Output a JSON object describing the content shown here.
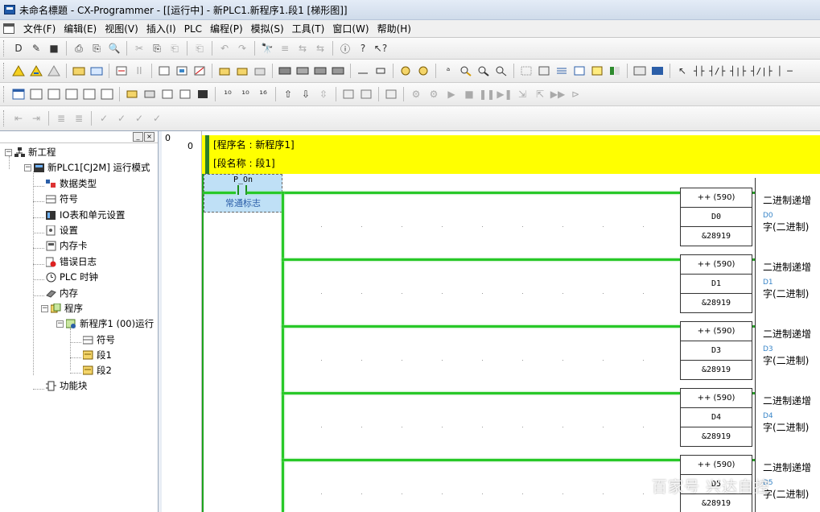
{
  "window": {
    "title": "未命名標題 - CX-Programmer - [[运行中] - 新PLC1.新程序1.段1 [梯形图]]"
  },
  "menu": [
    "文件(F)",
    "编辑(E)",
    "视图(V)",
    "插入(I)",
    "PLC",
    "编程(P)",
    "模拟(S)",
    "工具(T)",
    "窗口(W)",
    "帮助(H)"
  ],
  "toolbar1": [
    "D",
    "✎",
    "■",
    "⎙",
    "⎘",
    "🔍",
    "✂",
    "⎘",
    "⎗",
    "⎗",
    "↶",
    "↷",
    "🔭",
    "≡",
    "⇆",
    "⇆",
    "ⓘ",
    "?",
    "↖?"
  ],
  "toolbar2_ladder_symbols": [
    "┤├",
    "┤/├",
    "┤|├",
    "┤/|├",
    "│",
    "─"
  ],
  "tree": {
    "nodes": [
      {
        "label": "新工程",
        "icon": "project-icon"
      },
      {
        "label": "新PLC1[CJ2M] 运行模式",
        "icon": "plc-icon"
      },
      {
        "label": "数据类型",
        "icon": "datatype-icon"
      },
      {
        "label": "符号",
        "icon": "symbols-icon"
      },
      {
        "label": "IO表和单元设置",
        "icon": "io-table-icon"
      },
      {
        "label": "设置",
        "icon": "settings-icon"
      },
      {
        "label": "内存卡",
        "icon": "memory-card-icon"
      },
      {
        "label": "错误日志",
        "icon": "error-log-icon"
      },
      {
        "label": "PLC 时钟",
        "icon": "clock-icon"
      },
      {
        "label": "内存",
        "icon": "memory-icon"
      },
      {
        "label": "程序",
        "icon": "programs-icon"
      },
      {
        "label": "新程序1 (00)运行",
        "icon": "program-icon"
      },
      {
        "label": "符号",
        "icon": "symbols-icon"
      },
      {
        "label": "段1",
        "icon": "section-icon"
      },
      {
        "label": "段2",
        "icon": "section-icon"
      },
      {
        "label": "功能块",
        "icon": "function-block-icon"
      }
    ]
  },
  "rungs": {
    "number_top": "0",
    "number_rung": "0"
  },
  "ladder": {
    "comment_program": "[程序名 : 新程序1]",
    "comment_section": "[段名称 : 段1]",
    "contact": {
      "address": "P_On",
      "comment": "常通标志"
    },
    "instructions": [
      {
        "op": "++ (590)",
        "operand": "D0",
        "value": "&28919",
        "desc": "二进制递增",
        "sym": "D0",
        "type": "字(二进制)"
      },
      {
        "op": "++ (590)",
        "operand": "D1",
        "value": "&28919",
        "desc": "二进制递增",
        "sym": "D1",
        "type": "字(二进制)"
      },
      {
        "op": "++ (590)",
        "operand": "D3",
        "value": "&28919",
        "desc": "二进制递增",
        "sym": "D3",
        "type": "字(二进制)"
      },
      {
        "op": "++ (590)",
        "operand": "D4",
        "value": "&28919",
        "desc": "二进制递增",
        "sym": "D4",
        "type": "字(二进制)"
      },
      {
        "op": "++ (590)",
        "operand": "D5",
        "value": "&28919",
        "desc": "二进制递增",
        "sym": "D5",
        "type": "字(二进制)"
      }
    ]
  },
  "watermark": "百家号 兴达自控"
}
